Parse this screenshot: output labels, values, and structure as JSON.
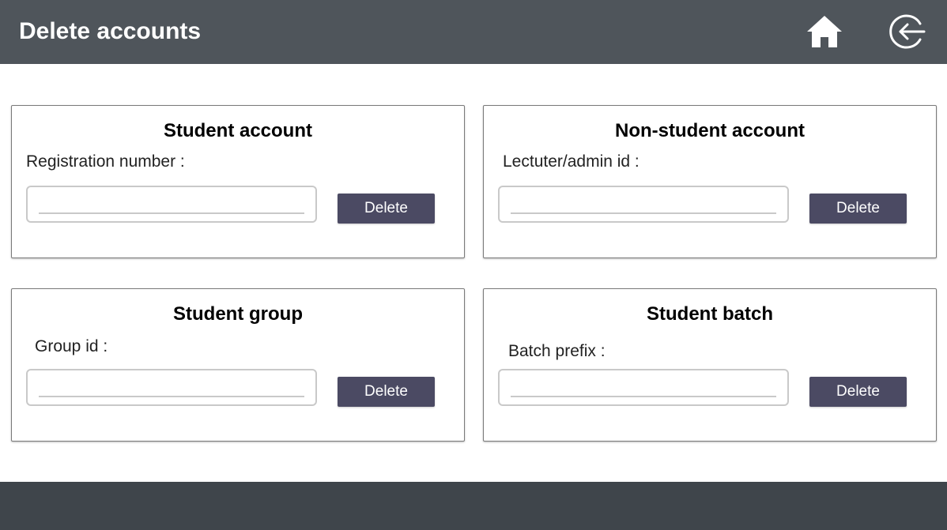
{
  "header": {
    "title": "Delete accounts",
    "home_icon": "home-icon",
    "logout_icon": "logout-arrow-icon"
  },
  "colors": {
    "header_bg": "#4f555b",
    "footer_bg": "#3f454b",
    "button_bg": "#4b4a63"
  },
  "cards": {
    "student_account": {
      "title": "Student account",
      "label": "Registration number :",
      "input_value": "",
      "button_label": "Delete"
    },
    "non_student_account": {
      "title": "Non-student account",
      "label": "Lectuter/admin id :",
      "input_value": "",
      "button_label": "Delete"
    },
    "student_group": {
      "title": "Student group",
      "label": "Group id :",
      "input_value": "",
      "button_label": "Delete"
    },
    "student_batch": {
      "title": "Student batch",
      "label": "Batch prefix :",
      "input_value": "",
      "button_label": "Delete"
    }
  }
}
